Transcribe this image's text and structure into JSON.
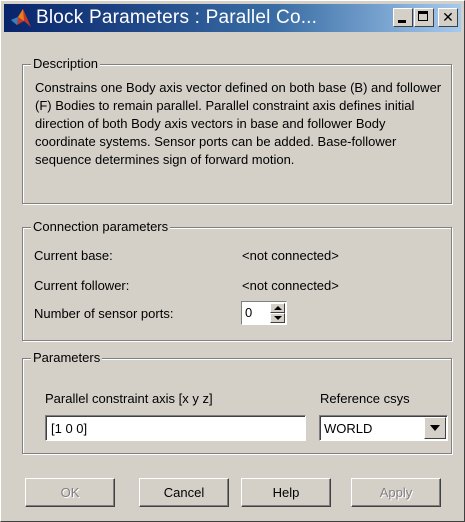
{
  "window": {
    "title": "Block Parameters : Parallel Co..."
  },
  "description": {
    "legend": "Description",
    "text": "Constrains one Body axis vector defined on both base (B) and follower (F) Bodies to remain parallel. Parallel constraint axis defines initial direction of both Body axis vectors in base and follower Body coordinate systems. Sensor ports can be added. Base-follower sequence determines sign of forward motion."
  },
  "connection": {
    "legend": "Connection parameters",
    "current_base_label": "Current base:",
    "current_base_value": "<not connected>",
    "current_follower_label": "Current follower:",
    "current_follower_value": "<not connected>",
    "sensor_ports_label": "Number of sensor ports:",
    "sensor_ports_value": "0"
  },
  "parameters": {
    "legend": "Parameters",
    "axis_label": "Parallel constraint axis [x y z]",
    "axis_value": "[1 0 0]",
    "csys_label": "Reference csys",
    "csys_value": "WORLD"
  },
  "buttons": {
    "ok": "OK",
    "cancel": "Cancel",
    "help": "Help",
    "apply": "Apply"
  }
}
